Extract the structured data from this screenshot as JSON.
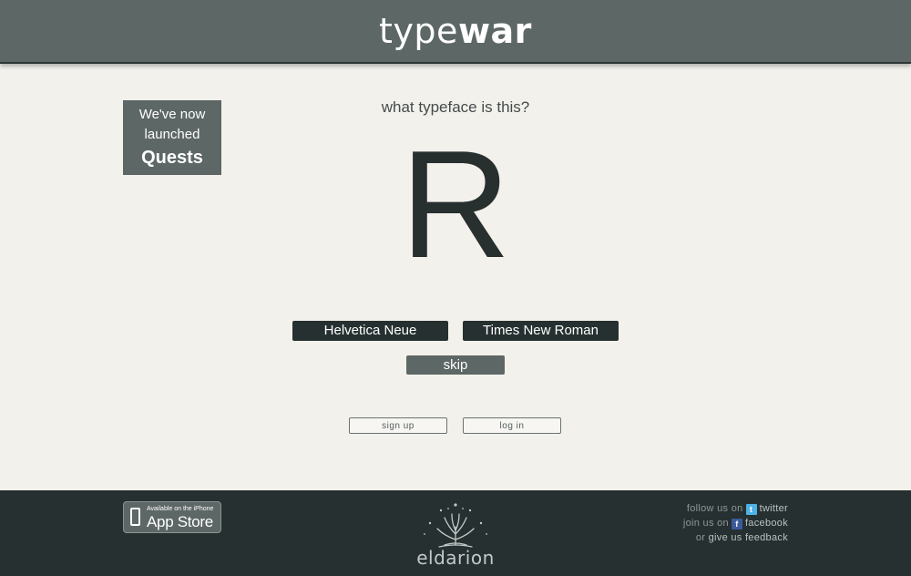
{
  "header": {
    "logo_light": "type",
    "logo_bold": "war"
  },
  "promo": {
    "line1": "We've now",
    "line2": "launched",
    "line3": "Quests"
  },
  "quiz": {
    "question": "what typeface is this?",
    "glyph": "R",
    "choices": [
      "Helvetica Neue",
      "Times New Roman"
    ],
    "skip_label": "skip"
  },
  "account": {
    "signup_label": "sign up",
    "login_label": "log in"
  },
  "footer": {
    "appstore_small": "Available on the iPhone",
    "appstore_big": "App Store",
    "brand": "eldarion",
    "follow_prefix": "follow us on",
    "twitter_label": "twitter",
    "join_prefix": "join us on",
    "facebook_label": "facebook",
    "or_prefix": "or",
    "feedback_label": "give us feedback",
    "twitter_icon": "t",
    "facebook_icon": "f"
  }
}
